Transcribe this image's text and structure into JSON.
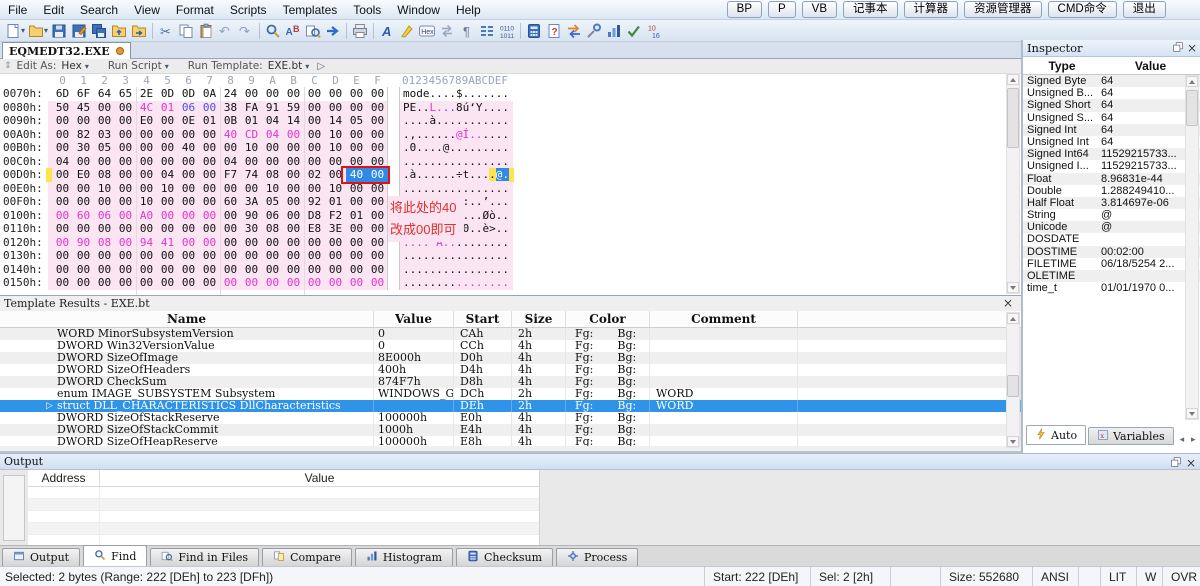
{
  "icons_text": {
    "chevron_down": "▾",
    "play": "▷",
    "close": "×",
    "twistie": "▷"
  },
  "menu": {
    "items": [
      "File",
      "Edit",
      "Search",
      "View",
      "Format",
      "Scripts",
      "Templates",
      "Tools",
      "Window",
      "Help"
    ],
    "quick_buttons": [
      "BP",
      "P",
      "VB",
      "记事本",
      "计算器",
      "资源管理器",
      "CMD命令",
      "退出"
    ]
  },
  "toolbar": {
    "items": [
      {
        "name": "new-file-icon",
        "kind": "doc",
        "dd": true
      },
      {
        "name": "open-file-icon",
        "kind": "folder",
        "dd": true
      },
      {
        "name": "save-icon",
        "kind": "disk"
      },
      {
        "name": "save-as-icon",
        "kind": "diskpen"
      },
      {
        "name": "save-all-icon",
        "kind": "disks"
      },
      {
        "name": "import-hex-icon",
        "kind": "folderup"
      },
      {
        "name": "export-hex-icon",
        "kind": "folderout"
      },
      {
        "sep": true
      },
      {
        "name": "cut-icon",
        "kind": "cut"
      },
      {
        "name": "copy-icon",
        "kind": "copy"
      },
      {
        "name": "paste-icon",
        "kind": "paste"
      },
      {
        "name": "undo-icon",
        "kind": "undo"
      },
      {
        "name": "redo-icon",
        "kind": "redo"
      },
      {
        "sep": true
      },
      {
        "name": "find-icon",
        "kind": "find"
      },
      {
        "name": "replace-icon",
        "kind": "replace"
      },
      {
        "name": "find-in-files-icon",
        "kind": "findfiles"
      },
      {
        "name": "goto-icon",
        "kind": "goto"
      },
      {
        "sep": true
      },
      {
        "name": "print-icon",
        "kind": "print"
      },
      {
        "sep": true
      },
      {
        "name": "font-icon",
        "kind": "font"
      },
      {
        "name": "highlight-icon",
        "kind": "highlight"
      },
      {
        "name": "hex-mode-icon",
        "kind": "hexbox"
      },
      {
        "name": "sync-view-icon",
        "kind": "sync"
      },
      {
        "name": "whitespace-icon",
        "kind": "para"
      },
      {
        "name": "columns-icon",
        "kind": "columns"
      },
      {
        "name": "binary-view-icon",
        "kind": "binary"
      },
      {
        "sep": true
      },
      {
        "name": "calculator-icon",
        "kind": "calc"
      },
      {
        "name": "script-help-icon",
        "kind": "dochelp"
      },
      {
        "name": "swap-bytes-icon",
        "kind": "swap"
      },
      {
        "name": "operations-icon",
        "kind": "tools"
      },
      {
        "name": "histogram-icon",
        "kind": "chart"
      },
      {
        "name": "check-icon",
        "kind": "check"
      },
      {
        "name": "base-converter-icon",
        "kind": "base"
      }
    ]
  },
  "file_tab": {
    "label": "EQMEDT32.EXE"
  },
  "hex_editor": {
    "toolbar": {
      "edit_as_label": "Edit As:",
      "edit_as_value": "Hex",
      "run_script_label": "Run Script",
      "run_template_label": "Run Template:",
      "run_template_value": "EXE.bt"
    },
    "column_header": {
      "cols": [
        "0",
        "1",
        "2",
        "3",
        "4",
        "5",
        "6",
        "7",
        "8",
        "9",
        "A",
        "B",
        "C",
        "D",
        "E",
        "F"
      ],
      "ascii": "0123456789ABCDEF"
    },
    "annotation": {
      "line1": "将此处的40",
      "line2": "改成00即可"
    },
    "rows": [
      {
        "a": "0070h:",
        "bg": "white",
        "h": "6D 6F 64 65 2E 0D 0D 0A 24 00 00 00 00 00 00 00",
        "c": {},
        "s": [
          [
            "mode....$.......",
            ""
          ]
        ]
      },
      {
        "a": "0080h:",
        "bg": "pink",
        "h": "50 45 00 00 4C 01 06 00 38 FA 91 59 00 00 00 00",
        "c": {
          "4": "m",
          "5": "m",
          "6": "b",
          "7": "b"
        },
        "s": [
          [
            "PE..",
            ""
          ],
          [
            "L.",
            "m"
          ],
          [
            "..",
            "b"
          ],
          [
            "8ú‘Y....",
            ""
          ]
        ]
      },
      {
        "a": "0090h:",
        "bg": "pink",
        "h": "00 00 00 00 E0 00 0E 01 0B 01 04 14 00 14 05 00",
        "c": {},
        "s": [
          [
            "....à...........",
            ""
          ]
        ]
      },
      {
        "a": "00A0h:",
        "bg": "pink",
        "h": "00 82 03 00 00 00 00 00 40 CD 04 00 00 10 00 00",
        "c": {
          "8": "m",
          "9": "m",
          "10": "m",
          "11": "m"
        },
        "s": [
          [
            ".‚......",
            ""
          ],
          [
            "@Í..",
            "m"
          ],
          [
            "....",
            ""
          ]
        ]
      },
      {
        "a": "00B0h:",
        "bg": "pink",
        "h": "00 30 05 00 00 00 40 00 00 10 00 00 00 10 00 00",
        "c": {},
        "s": [
          [
            ".0....@.........",
            ""
          ]
        ]
      },
      {
        "a": "00C0h:",
        "bg": "pink",
        "h": "04 00 00 00 00 00 00 00 04 00 00 00 00 00 00 00",
        "c": {},
        "s": [
          [
            "................",
            ""
          ]
        ]
      },
      {
        "a": "00D0h:",
        "bg": "pink",
        "h": "00 E0 08 00 00 04 00 00 F7 74 08 00 02 00 40 00",
        "c": {
          "14": "s",
          "15": "s"
        },
        "s": [
          [
            ".à......÷t...",
            ""
          ],
          [
            ".",
            "y"
          ],
          [
            "@.",
            "s"
          ]
        ],
        "marker": true,
        "yend": true
      },
      {
        "a": "00E0h:",
        "bg": "pink",
        "h": "00 00 10 00 00 10 00 00 00 00 10 00 00 10 00 00",
        "c": {},
        "s": [
          [
            "................",
            ""
          ]
        ]
      },
      {
        "a": "00F0h:",
        "bg": "pink",
        "h": "00 00 00 00 10 00 00 00 60 3A 05 00 92 01 00 00",
        "c": {},
        "s": [
          [
            "........`:..’...",
            ""
          ]
        ]
      },
      {
        "a": "0100h:",
        "bg": "pink",
        "h": "00 60 06 00 A0 00 00 00 00 90 06 00 D8 F2 01 00",
        "c": {
          "0": "m",
          "1": "m",
          "2": "m",
          "3": "m",
          "4": "m",
          "5": "m",
          "6": "m",
          "7": "m"
        },
        "s": [
          [
            ".`.. ...",
            "m"
          ],
          [
            "....Øò..",
            ""
          ]
        ]
      },
      {
        "a": "0110h:",
        "bg": "pink",
        "h": "00 00 00 00 00 00 00 00 00 30 08 00 E8 3E 00 00",
        "c": {},
        "s": [
          [
            ".........0..è>..",
            ""
          ]
        ]
      },
      {
        "a": "0120h:",
        "bg": "pink",
        "h": "00 90 08 00 94 41 00 00 00 00 00 00 00 00 00 00",
        "c": {
          "0": "m",
          "1": "m",
          "2": "m",
          "3": "m",
          "4": "m",
          "5": "m",
          "6": "m",
          "7": "m"
        },
        "s": [
          [
            "....”A..",
            "m"
          ],
          [
            "........",
            ""
          ]
        ]
      },
      {
        "a": "0130h:",
        "bg": "pink",
        "h": "00 00 00 00 00 00 00 00 00 00 00 00 00 00 00 00",
        "c": {},
        "s": [
          [
            "................",
            ""
          ]
        ]
      },
      {
        "a": "0140h:",
        "bg": "pink",
        "h": "00 00 00 00 00 00 00 00 00 00 00 00 00 00 00 00",
        "c": {},
        "s": [
          [
            "................",
            ""
          ]
        ]
      },
      {
        "a": "0150h:",
        "bg": "pink",
        "h": "00 00 00 00 00 00 00 00 00 00 00 00 00 00 00 00",
        "c": {
          "8": "m",
          "9": "m",
          "10": "m",
          "11": "m",
          "12": "m",
          "13": "m",
          "14": "m",
          "15": "m"
        },
        "s": [
          [
            "........",
            ""
          ],
          [
            "........",
            "m"
          ]
        ]
      }
    ],
    "selection": {
      "row_index": 6,
      "byte_start": 14,
      "byte_count": 2
    }
  },
  "template_results": {
    "title": "Template Results - EXE.bt",
    "columns": [
      "Name",
      "Value",
      "Start",
      "Size",
      "Color",
      "Comment"
    ],
    "fg_label": "Fg:",
    "bg_label": "Bg:",
    "rows": [
      {
        "name": "WORD MinorSubsystemVersion",
        "value": "0",
        "start": "CAh",
        "size": "2h",
        "comment": ""
      },
      {
        "name": "DWORD Win32VersionValue",
        "value": "0",
        "start": "CCh",
        "size": "4h",
        "comment": ""
      },
      {
        "name": "DWORD SizeOfImage",
        "value": "8E000h",
        "start": "D0h",
        "size": "4h",
        "comment": ""
      },
      {
        "name": "DWORD SizeOfHeaders",
        "value": "400h",
        "start": "D4h",
        "size": "4h",
        "comment": ""
      },
      {
        "name": "DWORD CheckSum",
        "value": "874F7h",
        "start": "D8h",
        "size": "4h",
        "comment": ""
      },
      {
        "name": "enum IMAGE_SUBSYSTEM Subsystem",
        "value": "WINDOWS_GUI …",
        "start": "DCh",
        "size": "2h",
        "comment": "WORD"
      },
      {
        "name": "struct DLL_CHARACTERISTICS DllCharacteristics",
        "value": "",
        "start": "DEh",
        "size": "2h",
        "comment": "WORD",
        "selected": true
      },
      {
        "name": "DWORD SizeOfStackReserve",
        "value": "100000h",
        "start": "E0h",
        "size": "4h",
        "comment": ""
      },
      {
        "name": "DWORD SizeOfStackCommit",
        "value": "1000h",
        "start": "E4h",
        "size": "4h",
        "comment": ""
      },
      {
        "name": "DWORD SizeOfHeapReserve",
        "value": "100000h",
        "start": "E8h",
        "size": "4h",
        "comment": ""
      }
    ]
  },
  "inspector": {
    "title": "Inspector",
    "columns": [
      "Type",
      "Value"
    ],
    "rows": [
      [
        "Signed Byte",
        "64"
      ],
      [
        "Unsigned B...",
        "64"
      ],
      [
        "Signed Short",
        "64"
      ],
      [
        "Unsigned S...",
        "64"
      ],
      [
        "Signed Int",
        "64"
      ],
      [
        "Unsigned Int",
        "64"
      ],
      [
        "Signed Int64",
        "11529215733..."
      ],
      [
        "Unsigned I...",
        "11529215733..."
      ],
      [
        "Float",
        "8.96831e-44"
      ],
      [
        "Double",
        "1.288249410..."
      ],
      [
        "Half Float",
        "3.814697e-06"
      ],
      [
        "String",
        "@"
      ],
      [
        "Unicode",
        "@"
      ],
      [
        "DOSDATE",
        ""
      ],
      [
        "DOSTIME",
        "00:02:00"
      ],
      [
        "FILETIME",
        "06/18/5254 2..."
      ],
      [
        "OLETIME",
        ""
      ],
      [
        "time_t",
        "01/01/1970 0..."
      ]
    ],
    "tabs": [
      {
        "label": "Auto",
        "icon": "lightning",
        "active": true
      },
      {
        "label": "Variables",
        "icon": "varicon",
        "active": false
      }
    ]
  },
  "output_panel": {
    "title": "Output",
    "columns": [
      "Address",
      "Value"
    ],
    "empty_rows": 5
  },
  "bottom_tabs": [
    {
      "label": "Output",
      "icon": "window",
      "active": false
    },
    {
      "label": "Find",
      "icon": "find",
      "active": true
    },
    {
      "label": "Find in Files",
      "icon": "findfiles",
      "active": false
    },
    {
      "label": "Compare",
      "icon": "pages",
      "active": false
    },
    {
      "label": "Histogram",
      "icon": "chart",
      "active": false
    },
    {
      "label": "Checksum",
      "icon": "calc",
      "active": false
    },
    {
      "label": "Process",
      "icon": "gear",
      "active": false
    }
  ],
  "status_bar": {
    "selection_text": "Selected: 2 bytes (Range: 222 [DEh] to 223 [DFh])",
    "start": "Start: 222 [DEh]",
    "sel": "Sel: 2 [2h]",
    "size": "Size: 552680",
    "encoding": "ANSI",
    "endian": "LIT",
    "w": "W",
    "ovr": "OVR"
  },
  "colors": {
    "hex_pink": "#fbe5f3",
    "hex_magenta": "#e531cf",
    "hex_blue": "#5050dd",
    "selection_blue": "#2e8ae6",
    "row_selection": "#2f93e8",
    "annotation_red": "#e23030",
    "caret_yellow": "#ffe34d",
    "red_box": "#e01212"
  }
}
